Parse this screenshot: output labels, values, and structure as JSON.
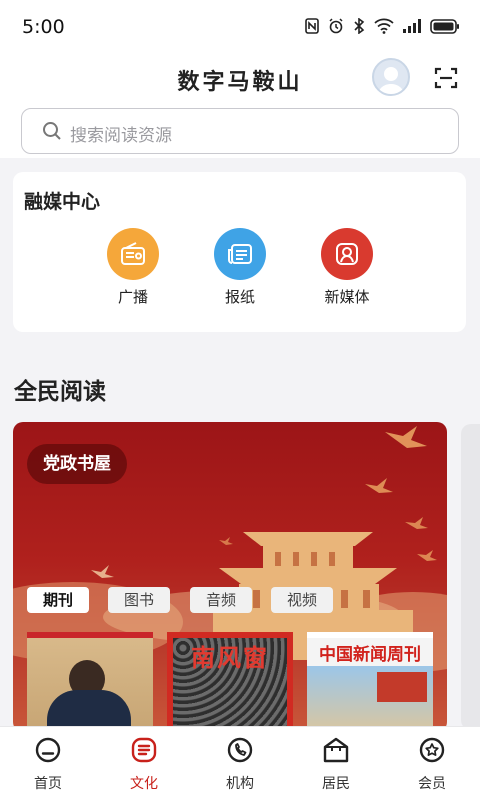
{
  "status_bar": {
    "time": "5:00"
  },
  "header": {
    "title": "数字马鞍山"
  },
  "search": {
    "placeholder": "搜索阅读资源"
  },
  "media_center": {
    "title": "融媒中心",
    "items": [
      {
        "label": "广播",
        "icon": "radio-icon",
        "color": "#f5a73a"
      },
      {
        "label": "报纸",
        "icon": "newspaper-icon",
        "color": "#3fa3e6"
      },
      {
        "label": "新媒体",
        "icon": "new-media-icon",
        "color": "#d93a2f"
      }
    ]
  },
  "reading": {
    "title": "全民阅读",
    "banner": {
      "badge": "党政书屋",
      "tabs": [
        {
          "label": "期刊",
          "active": true
        },
        {
          "label": "图书",
          "active": false
        },
        {
          "label": "音频",
          "active": false
        },
        {
          "label": "视频",
          "active": false
        }
      ],
      "covers": [
        {
          "title": ""
        },
        {
          "title": "南风窗"
        },
        {
          "title": "中国新闻周刊"
        }
      ]
    }
  },
  "bottom_nav": {
    "active": "文化",
    "items": [
      {
        "label": "首页",
        "icon": "home-icon"
      },
      {
        "label": "文化",
        "icon": "culture-icon"
      },
      {
        "label": "机构",
        "icon": "institution-icon"
      },
      {
        "label": "居民",
        "icon": "resident-icon"
      },
      {
        "label": "会员",
        "icon": "member-icon"
      }
    ]
  },
  "colors": {
    "accent": "#c8211b",
    "banner_red": "#a9191b"
  }
}
